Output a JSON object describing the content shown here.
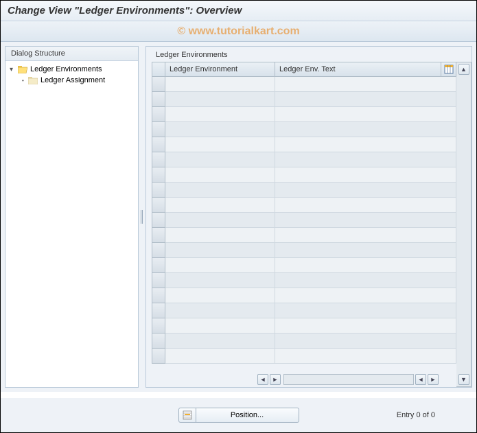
{
  "title": "Change View \"Ledger Environments\": Overview",
  "watermark": "© www.tutorialkart.com",
  "tree": {
    "header": "Dialog Structure",
    "root": {
      "label": "Ledger Environments",
      "expanded": true
    },
    "child": {
      "label": "Ledger Assignment"
    }
  },
  "group_title": "Ledger Environments",
  "columns": {
    "col1": "Ledger Environment",
    "col2": "Ledger Env. Text"
  },
  "footer": {
    "position_label": "Position...",
    "entry_label": "Entry 0 of 0"
  }
}
